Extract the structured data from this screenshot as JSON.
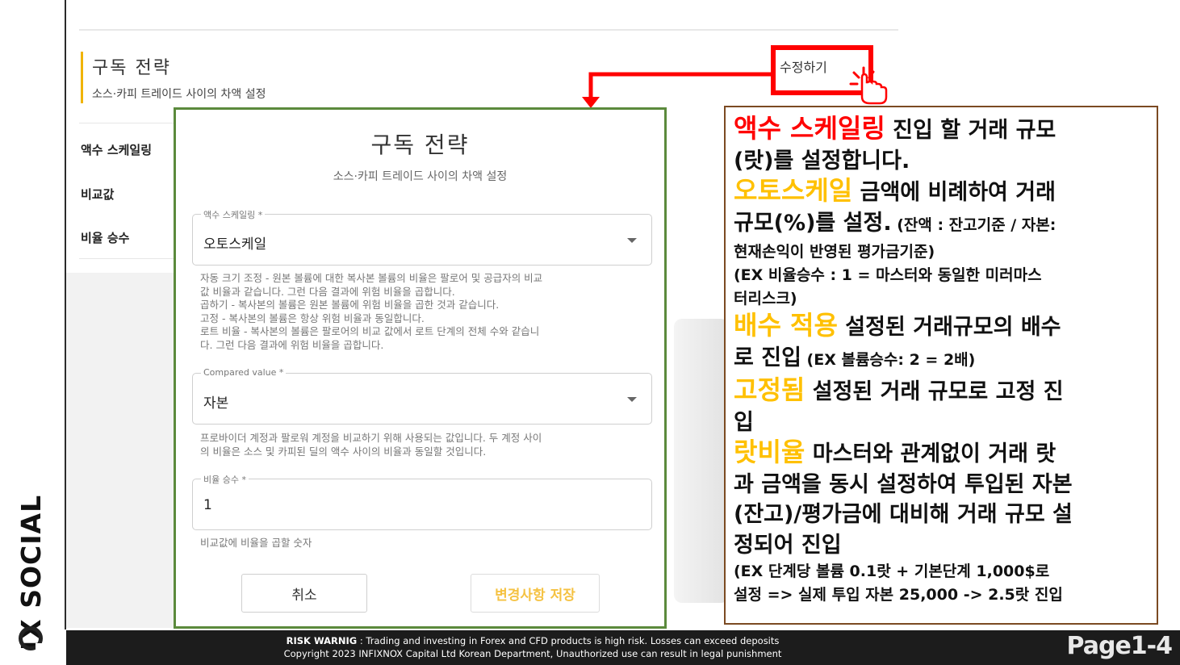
{
  "brand": {
    "name": "IX SOCIAL"
  },
  "background": {
    "title": "구독 전략",
    "subtitle": "소스·카피 트레이드 사이의 차액 설정",
    "edit_button": "수정하기",
    "rows": [
      "액수 스케일링",
      "비교값",
      "비율 승수"
    ]
  },
  "modal": {
    "title": "구독 전략",
    "subtitle": "소스·카피 트레이드 사이의 차액 설정",
    "fields": [
      {
        "label": "액수 스케일링 *",
        "value": "오토스케일",
        "help": [
          "자동 크기 조정 - 원본 볼륨에 대한 복사본 볼륨의 비율은 팔로어 및 공급자의 비교",
          "값 비율과 같습니다. 그런 다음 결과에 위험 비율을 곱합니다.",
          "곱하기 - 복사본의 볼륨은 원본 볼륨에 위험 비율을 곱한 것과 같습니다.",
          "고정 - 복사본의 볼륨은 항상 위험 비율과 동일합니다.",
          "로트 비율 - 복사본의 볼륨은 팔로어의 비교 값에서 로트 단계의 전체 수와 같습니",
          "다. 그런 다음 결과에 위험 비율을 곱합니다."
        ]
      },
      {
        "label": "Compared value *",
        "value": "자본",
        "help": [
          "프로바이더 계정과 팔로워 계정을 비교하기 위해 사용되는 값입니다. 두 계정 사이",
          "의 비율은 소스 및 카피된 딜의 액수 사이의 비율과 동일할 것입니다."
        ]
      },
      {
        "label": "비율 승수 *",
        "value": "1",
        "help": [
          "비교값에 비율을 곱할 숫자"
        ]
      }
    ],
    "cancel_label": "취소",
    "save_label": "변경사항 저장"
  },
  "note": {
    "p1": {
      "kw": "액수 스케일링",
      "l1": " 진입 할 거래 규모",
      "l2": "(랏)를 설정합니다."
    },
    "p2": {
      "kw": "오토스케일",
      "l1": " 금액에 비례하여 거래",
      "l2a": "규모(%)를 설정.",
      "l2b": " (잔액 : 잔고기준 / 자본:",
      "l3": "현재손익이  반영된 평가금기준)",
      "l4": "(EX 비율승수 : 1 = 마스터와 동일한 미러마스",
      "l5": "터리스크)"
    },
    "p3": {
      "kw": "배수 적용",
      "l1": " 설정된 거래규모의 배수",
      "l2a": "로 진입",
      "l2b": " (EX 볼륨승수: 2 = 2배)"
    },
    "p4": {
      "kw": "고정됨",
      "l1": " 설정된 거래 규모로 고정 진",
      "l2": "입"
    },
    "p5": {
      "kw": "랏비율",
      "l1": " 마스터와 관계없이 거래 랏",
      "l2": "과 금액을 동시 설정하여 투입된 자본",
      "l3": "(잔고)/평가금에 대비해 거래 규모 설",
      "l4": "정되어 진입",
      "l5": "(EX 단계당 볼륨 0.1랏 + 기본단계 1,000$로",
      "l6": "설정 => 실제 투입 자본 25,000 -> 2.5랏 진입"
    }
  },
  "footer": {
    "warning_bold": "RISK WARNIG",
    "warning_text": " : Trading and investing in Forex and CFD products is high risk. Losses can exceed deposits",
    "copyright": "Copyright 2023 INFIXNOX Capital Ltd Korean Department, Unauthorized use can result in legal punishment",
    "page": "Page1-4"
  },
  "colors": {
    "highlight_red": "#ff0000",
    "highlight_gold": "#ffc000",
    "modal_border": "#5b8a3c",
    "accent": "#f0b400",
    "note_border": "#7b4a22"
  }
}
